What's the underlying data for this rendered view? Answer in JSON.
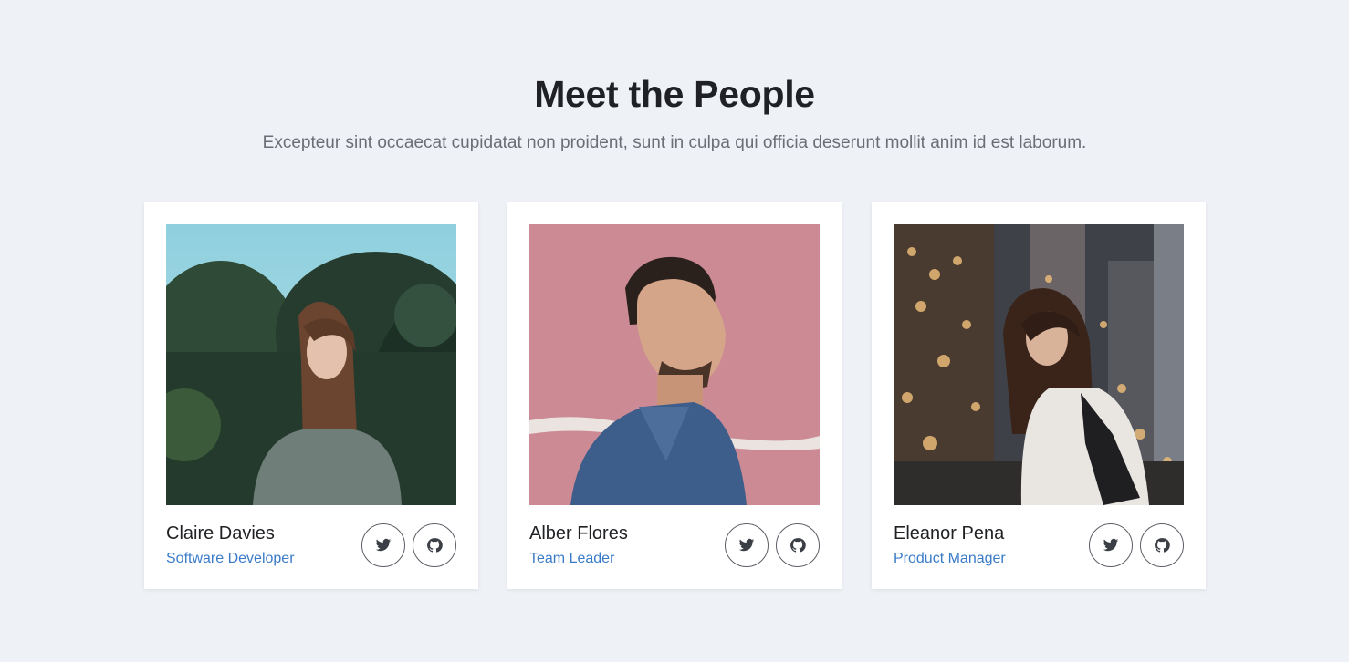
{
  "header": {
    "title": "Meet the People",
    "subtitle": "Excepteur sint occaecat cupidatat non proident, sunt in culpa qui officia deserunt mollit anim id est laborum."
  },
  "people": [
    {
      "name": "Claire Davies",
      "role": "Software Developer",
      "photo": "woman-forest-portrait",
      "social": [
        "twitter-icon",
        "github-icon"
      ]
    },
    {
      "name": "Alber Flores",
      "role": "Team Leader",
      "photo": "man-pink-wall-portrait",
      "social": [
        "twitter-icon",
        "github-icon"
      ]
    },
    {
      "name": "Eleanor Pena",
      "role": "Product Manager",
      "photo": "woman-city-night-portrait",
      "social": [
        "twitter-icon",
        "github-icon"
      ]
    }
  ],
  "colors": {
    "background": "#eef1f6",
    "card": "#ffffff",
    "title": "#1f2124",
    "subtitle": "#6b6f75",
    "role": "#3a7bc8"
  }
}
